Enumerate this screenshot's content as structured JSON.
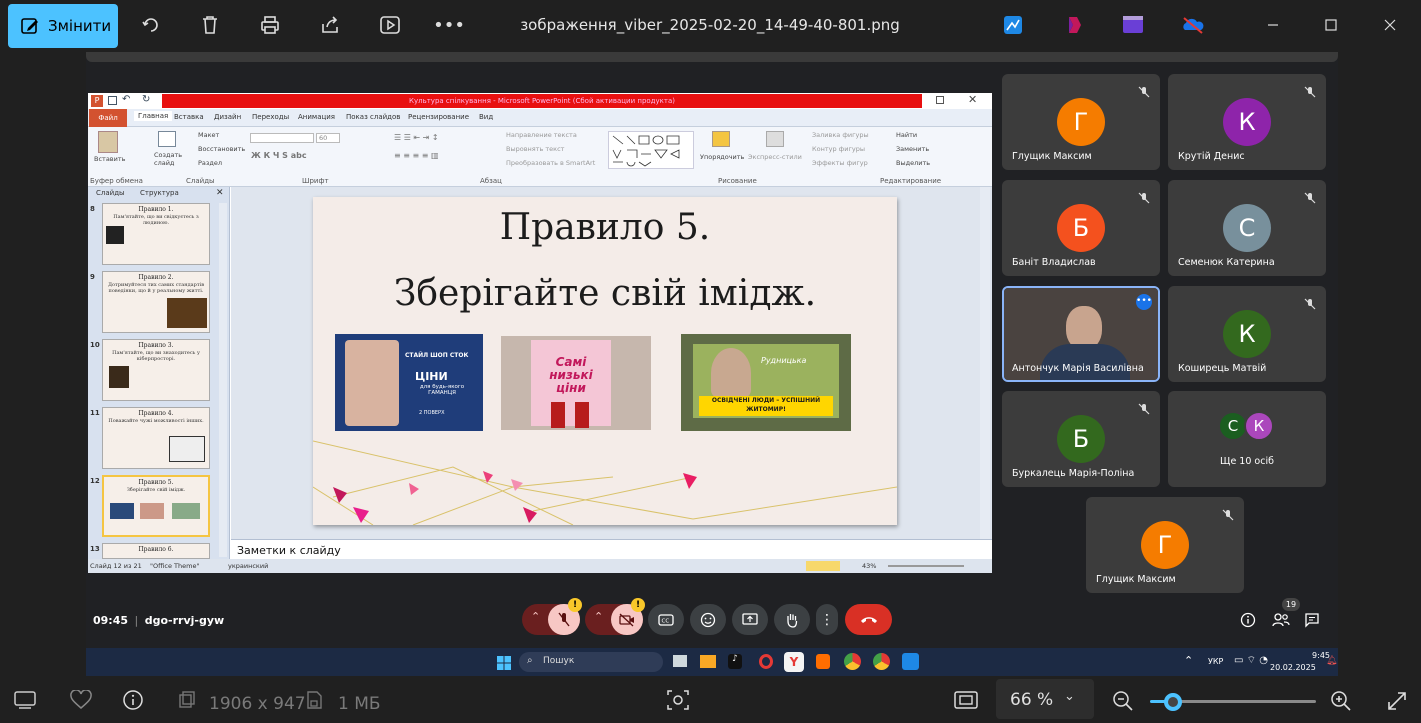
{
  "toolbar": {
    "edit_label": "Змінити",
    "file_name": "зображення_viber_2025-02-20_14-49-40-801.png"
  },
  "ppt": {
    "title": "Культура спілкування - Microsoft PowerPoint (Сбой активации продукта)",
    "file_tab": "Файл",
    "tabs": [
      "Главная",
      "Вставка",
      "Дизайн",
      "Переходы",
      "Анимация",
      "Показ слайдов",
      "Рецензирование",
      "Вид"
    ],
    "ribbon_groups": [
      "Буфер обмена",
      "Слайды",
      "Шрифт",
      "Абзац",
      "Рисование",
      "Редактирование"
    ],
    "ribbon_items": {
      "paste": "Вставить",
      "new_slide": "Создать слайд",
      "layout": "Макет",
      "reset": "Восстановить",
      "section": "Раздел",
      "text_direction": "Направление текста",
      "align_text": "Выровнять текст",
      "smartart": "Преобразовать в SmartArt",
      "arrange": "Упорядочить",
      "quick_styles": "Экспресс-стили",
      "shape_fill": "Заливка фигуры",
      "shape_outline": "Контур фигуры",
      "shape_effects": "Эффекты фигур",
      "find": "Найти",
      "replace": "Заменить",
      "select": "Выделить",
      "font_size": "60"
    },
    "left_tabs": [
      "Слайды",
      "Структура"
    ],
    "thumbs": [
      {
        "num": "8",
        "title": "Правило 1.",
        "sub": "Пам'ятайте, що ви свідкуєтесь з людиною."
      },
      {
        "num": "9",
        "title": "Правило 2.",
        "sub": "Дотримуйтеся тих самих стандартів поведінки, що й у реальному житті."
      },
      {
        "num": "10",
        "title": "Правило 3.",
        "sub": "Пам'ятайте, що ви знаходитесь у кіберпросторі."
      },
      {
        "num": "11",
        "title": "Правило 4.",
        "sub": "Поважайте чужі можливості інших."
      },
      {
        "num": "12",
        "title": "Правило 5.",
        "sub": "Зберігайте свій імідж."
      },
      {
        "num": "13",
        "title": "Правило 6.",
        "sub": ""
      }
    ],
    "slide_title": "Правило 5.",
    "slide_subtitle": "Зберігайте свій імідж.",
    "billboards": {
      "b1_brand": "СТАЙЛ ШОП СТОК",
      "b1_text1": "ЦІНИ",
      "b1_text2": "для будь-якого ГАМАНЦЯ",
      "b1_text3": "2 ПОВЕРХ",
      "b2_text": "Самі низькі ціни",
      "b3_name": "Рудницька",
      "b3_text": "ОСВІДЧЕНІ ЛЮДИ – УСПІШНИЙ ЖИТОМИР!"
    },
    "notes": "Заметки к слайду",
    "status_left": "Слайд 12 из 21",
    "status_theme": "\"Office Theme\"",
    "status_lang": "украинский",
    "zoom": "43%"
  },
  "participants": [
    {
      "name": "Глущик Максим",
      "initial": "Г",
      "color": "#f57c00"
    },
    {
      "name": "Крутій Денис",
      "initial": "К",
      "color": "#8e24aa"
    },
    {
      "name": "Баніт Владислав",
      "initial": "Б",
      "color": "#f4511e"
    },
    {
      "name": "Семенюк Катерина",
      "initial": "С",
      "color": "#78909c"
    },
    {
      "name": "Антончук Марія Василівна",
      "initial": "",
      "color": "#000000"
    },
    {
      "name": "Коширець Матвій",
      "initial": "К",
      "color": "#33691e"
    },
    {
      "name": "Буркалець Марія-Поліна",
      "initial": "Б",
      "color": "#33691e"
    },
    {
      "name": "Ще 10 осіб",
      "initial": "",
      "color": "#000000"
    },
    {
      "name": "Глущик Максим",
      "initial": "Г",
      "color": "#f57c00"
    }
  ],
  "more_avatars": [
    "С",
    "К"
  ],
  "meet": {
    "time": "09:45",
    "code": "dgo-rrvj-gyw",
    "people_count": "19"
  },
  "taskbar": {
    "search": "Пошук",
    "lang": "УКР",
    "time": "9:45",
    "date": "20.02.2025"
  },
  "viewer": {
    "dimensions": "1906 x 947",
    "size": "1 МБ",
    "zoom": "66 %"
  },
  "colors": {
    "accent": "#4cc2ff",
    "end_call": "#d93025",
    "muted_control": "#f7c7c4"
  }
}
